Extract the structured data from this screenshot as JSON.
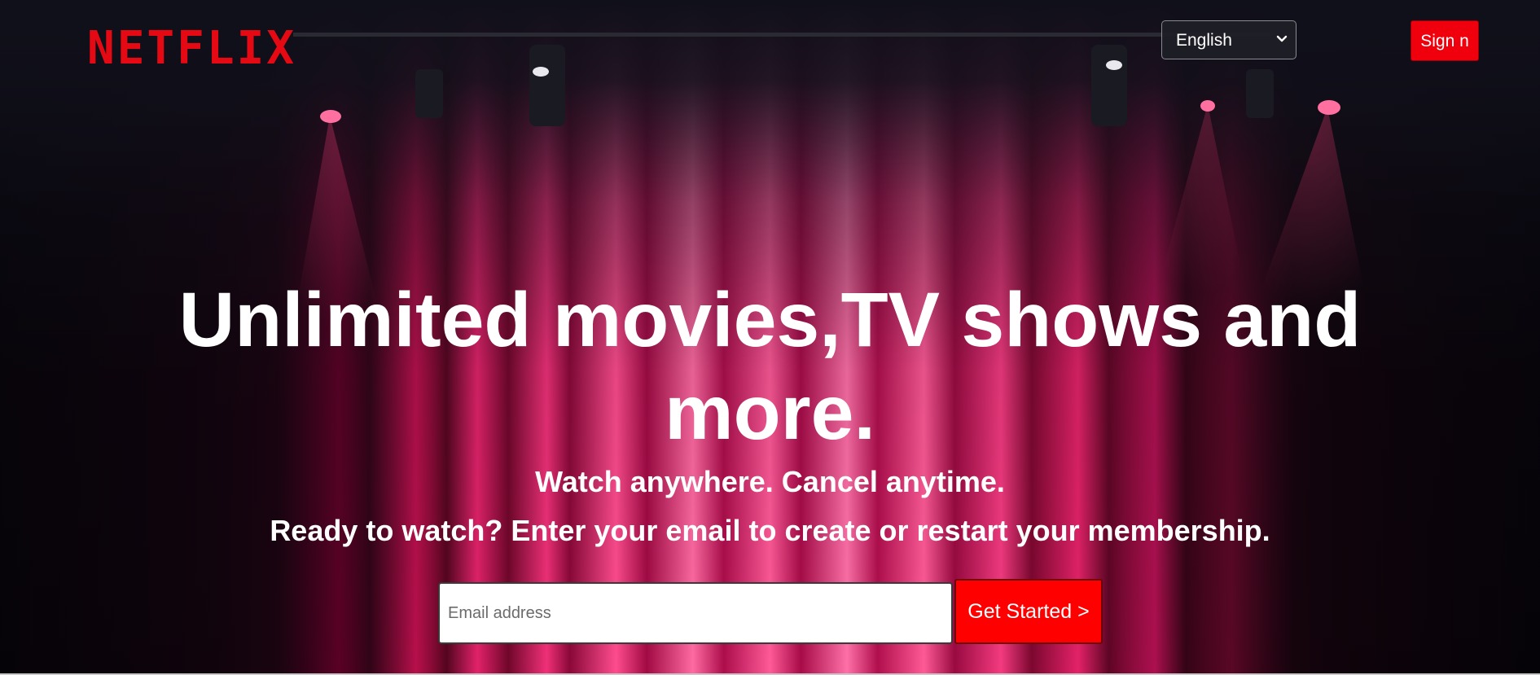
{
  "header": {
    "logo_text": "NETFLIX",
    "language_select": {
      "selected": "English",
      "icon": "chevron-down-icon"
    },
    "signin_label": "Sign n"
  },
  "hero": {
    "headline_line1": "Unlimited movies,TV shows and",
    "headline_line2": "more.",
    "subheading": "Watch anywhere. Cancel anytime.",
    "prompt": "Ready to watch? Enter your email to create or restart your membership."
  },
  "signup": {
    "email_placeholder": "Email address",
    "email_value": "",
    "cta_label": "Get Started >"
  },
  "colors": {
    "brand_red": "#e50914",
    "button_red": "#ff0000",
    "text": "#ffffff",
    "curtain": "#d1004d"
  }
}
